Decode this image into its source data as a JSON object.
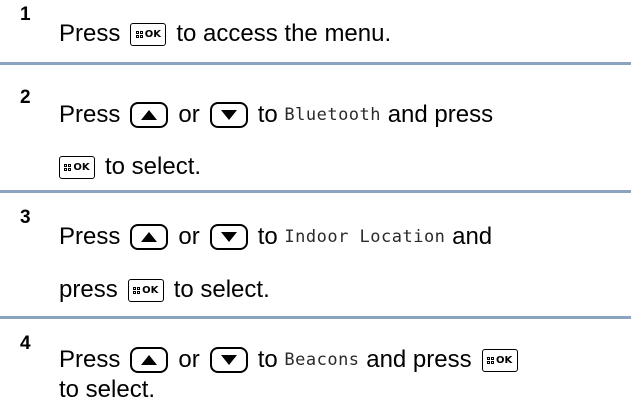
{
  "steps": [
    {
      "number": "1",
      "t_press": "Press",
      "t_rest": "to access the menu."
    },
    {
      "number": "2",
      "t_press": "Press",
      "t_or": "or",
      "t_to": "to",
      "item": "Bluetooth",
      "t_and": "and press",
      "t_select": "to select."
    },
    {
      "number": "3",
      "t_press": "Press",
      "t_or": "or",
      "t_to": "to",
      "item": "Indoor Location",
      "t_and": "and",
      "t_press2": "press",
      "t_select": "to select."
    },
    {
      "number": "4",
      "t_press": "Press",
      "t_or": "or",
      "t_to": "to",
      "item": "Beacons",
      "t_and": "and press",
      "t_select": "to select."
    }
  ],
  "buttons": {
    "ok_label": "OK",
    "up_icon": "up-arrow-icon",
    "down_icon": "down-arrow-icon",
    "menu_icon": "menu-grid-icon"
  },
  "colors": {
    "separator": "#8aa3bf"
  }
}
